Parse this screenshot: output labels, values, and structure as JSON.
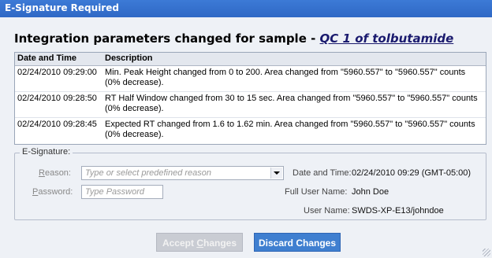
{
  "window": {
    "title": "E-Signature Required"
  },
  "heading": {
    "prefix": "Integration parameters changed for sample - ",
    "sample": "QC 1 of tolbutamide"
  },
  "table": {
    "columns": [
      "Date and Time",
      "Description"
    ],
    "rows": [
      {
        "date": "02/24/2010 09:29:00",
        "description": "Min. Peak Height changed from 0 to 200. Area changed from \"5960.557\" to \"5960.557\" counts (0% decrease)."
      },
      {
        "date": "02/24/2010 09:28:50",
        "description": "RT Half Window changed from 30 to 15 sec. Area changed from \"5960.557\" to \"5960.557\" counts (0% decrease)."
      },
      {
        "date": "02/24/2010 09:28:45",
        "description": "Expected RT changed from 1.6 to 1.62 min. Area changed from \"5960.557\" to \"5960.557\" counts (0% decrease)."
      }
    ]
  },
  "esig": {
    "legend": "E-Signature:",
    "reason_label_u": "R",
    "reason_label_rest": "eason:",
    "reason_placeholder": "Type or select predefined reason",
    "password_label_u": "P",
    "password_label_rest": "assword:",
    "password_placeholder": "Type Password",
    "date_label": "Date and Time:",
    "date_value": "02/24/2010 09:29 (GMT-05:00)",
    "fullname_label": "Full User Name:",
    "fullname_value": "John Doe",
    "username_label": "User Name:",
    "username_value": "SWDS-XP-E13/johndoe"
  },
  "buttons": {
    "accept_pre": "Accept ",
    "accept_u": "C",
    "accept_post": "hanges",
    "discard": "Discard Changes"
  }
}
